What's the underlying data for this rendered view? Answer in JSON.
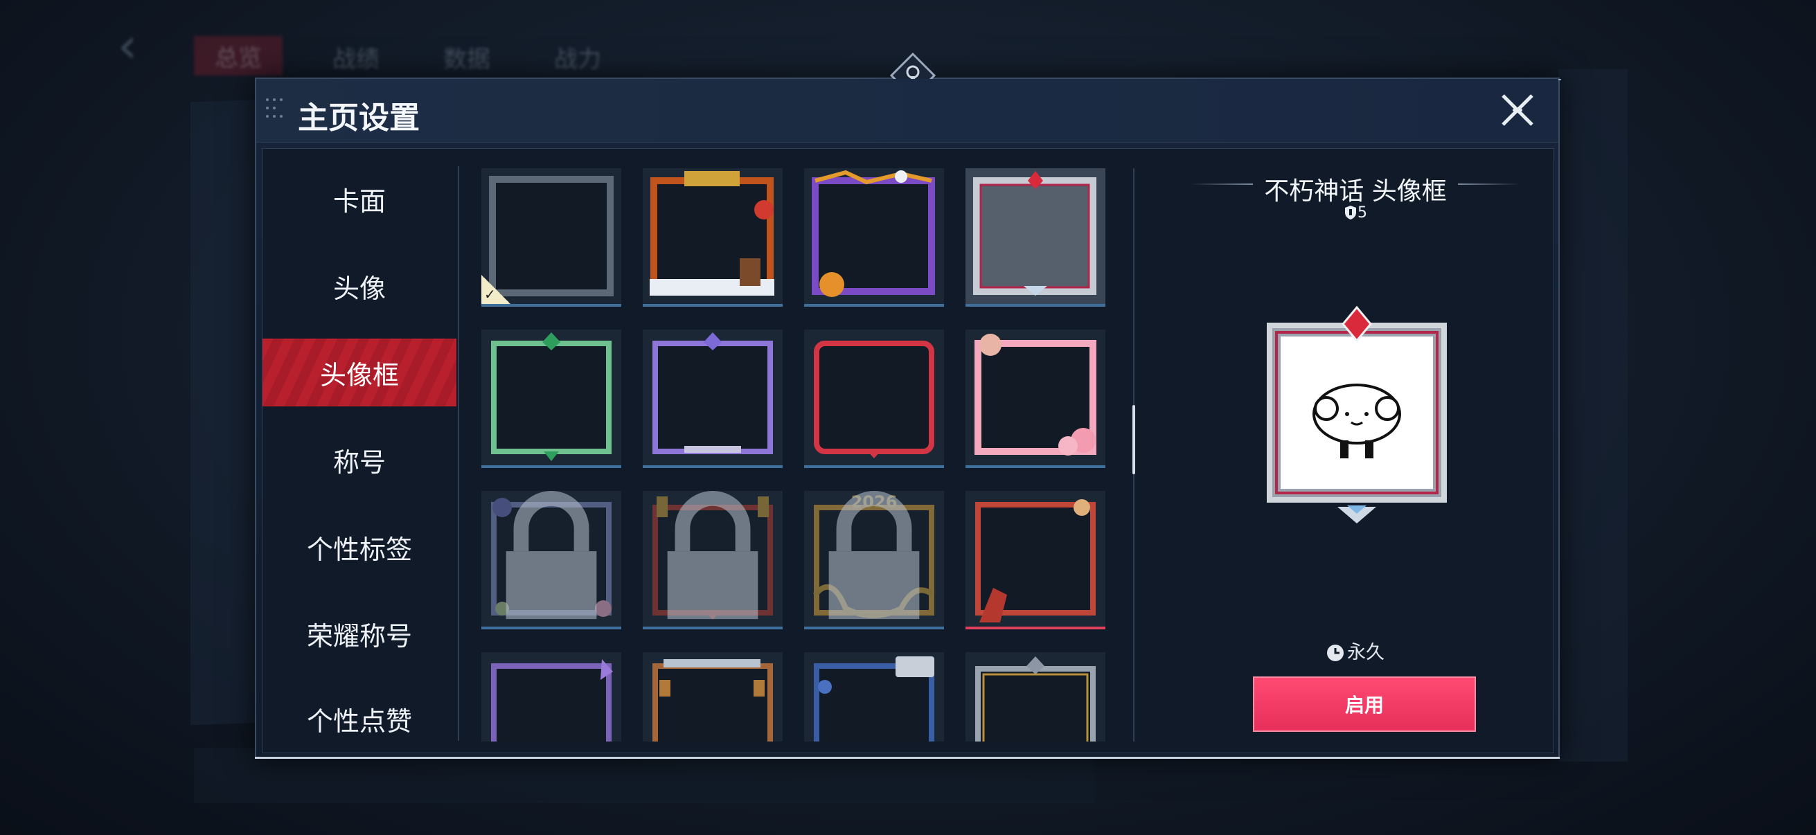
{
  "background": {
    "tabs": [
      "总览",
      "战绩",
      "数据",
      "战力"
    ]
  },
  "modal": {
    "title": "主页设置",
    "close_icon": "close-icon"
  },
  "nav": {
    "items": [
      {
        "label": "卡面",
        "active": false
      },
      {
        "label": "头像",
        "active": false
      },
      {
        "label": "头像框",
        "active": true
      },
      {
        "label": "称号",
        "active": false
      },
      {
        "label": "个性标签",
        "active": false
      },
      {
        "label": "荣耀称号",
        "active": false
      },
      {
        "label": "个性点赞",
        "active": false
      }
    ]
  },
  "grid": {
    "frames": [
      {
        "name": "default-frame",
        "selected": false,
        "equipped": true,
        "locked": false
      },
      {
        "name": "spring-festival-frame",
        "selected": false,
        "equipped": false,
        "locked": false
      },
      {
        "name": "halloween-frame",
        "selected": false,
        "equipped": false,
        "locked": false
      },
      {
        "name": "immortal-myth-frame",
        "selected": true,
        "equipped": false,
        "locked": false
      },
      {
        "name": "emerald-frame",
        "selected": false,
        "equipped": false,
        "locked": false
      },
      {
        "name": "violet-frame",
        "selected": false,
        "equipped": false,
        "locked": false
      },
      {
        "name": "crimson-frame",
        "selected": false,
        "equipped": false,
        "locked": false
      },
      {
        "name": "sakura-bear-frame",
        "selected": false,
        "equipped": false,
        "locked": false
      },
      {
        "name": "floral-frame",
        "selected": false,
        "equipped": false,
        "locked": true
      },
      {
        "name": "red-gate-frame",
        "selected": false,
        "equipped": false,
        "locked": true
      },
      {
        "name": "golden-2026-frame",
        "selected": false,
        "equipped": false,
        "locked": true,
        "label": "2026"
      },
      {
        "name": "horse-frame",
        "selected": false,
        "equipped": false,
        "locked": false
      },
      {
        "name": "purple-gem-frame",
        "selected": false,
        "equipped": false,
        "locked": false
      },
      {
        "name": "bronze-lantern-frame",
        "selected": false,
        "equipped": false,
        "locked": false
      },
      {
        "name": "blue-mech-frame",
        "selected": false,
        "equipped": false,
        "locked": false
      },
      {
        "name": "silver-gold-frame",
        "selected": false,
        "equipped": false,
        "locked": false
      }
    ]
  },
  "detail": {
    "title": "不朽神话 头像框",
    "level": "5",
    "duration": "永久",
    "enable_label": "启用",
    "accent": "#e62f5a"
  }
}
